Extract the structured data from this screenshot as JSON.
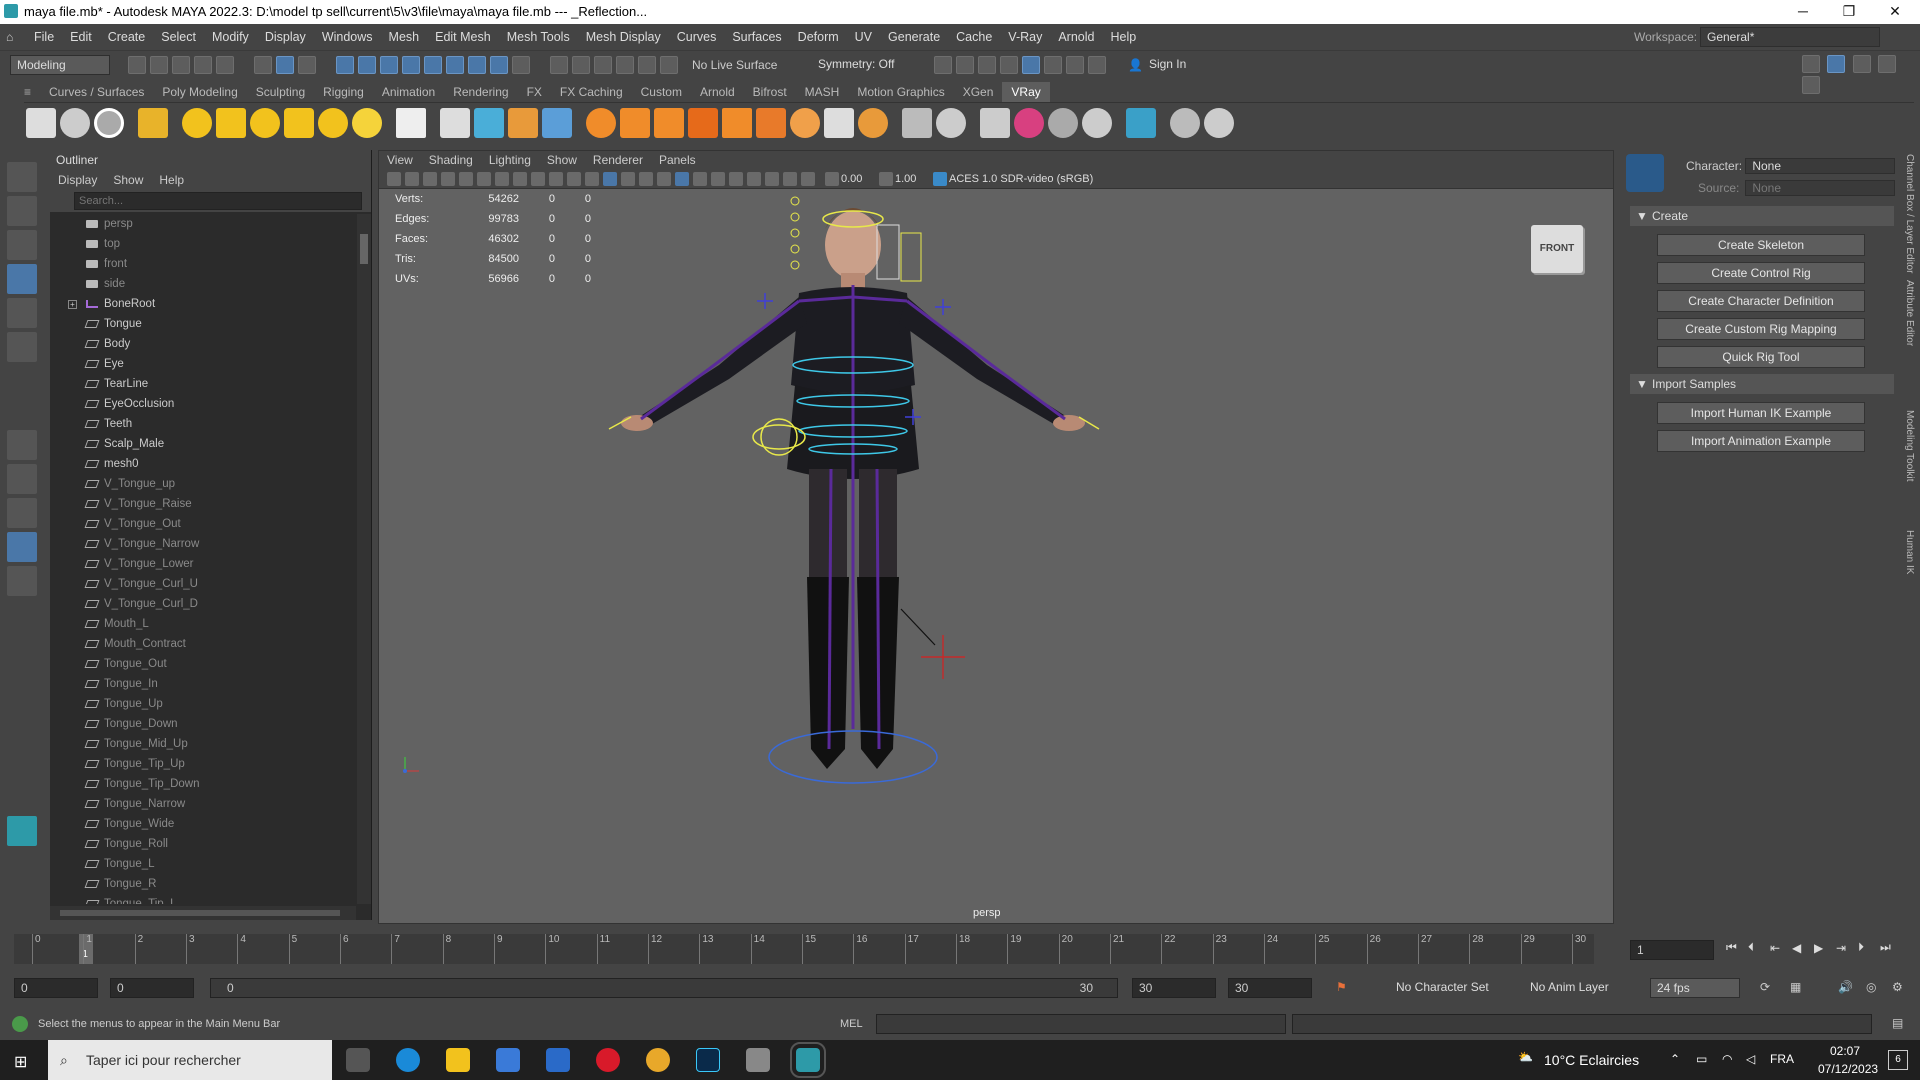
{
  "titlebar": {
    "title": "maya file.mb* - Autodesk MAYA 2022.3: D:\\model tp sell\\current\\5\\v3\\file\\maya\\maya file.mb  ---  _Reflection...",
    "minimize": "─",
    "maximize": "❐",
    "close": "✕"
  },
  "menubar": {
    "items": [
      "File",
      "Edit",
      "Create",
      "Select",
      "Modify",
      "Display",
      "Windows",
      "Mesh",
      "Edit Mesh",
      "Mesh Tools",
      "Mesh Display",
      "Curves",
      "Surfaces",
      "Deform",
      "UV",
      "Generate",
      "Cache",
      "V-Ray",
      "Arnold",
      "Help"
    ],
    "workspace_label": "Workspace:",
    "workspace_value": "General*"
  },
  "statusline": {
    "mode": "Modeling",
    "live_surface": "No Live Surface",
    "symmetry": "Symmetry: Off",
    "sign_in": "Sign In"
  },
  "shelf": {
    "tabs": [
      "Curves / Surfaces",
      "Poly Modeling",
      "Sculpting",
      "Rigging",
      "Animation",
      "Rendering",
      "FX",
      "FX Caching",
      "Custom",
      "Arnold",
      "Bifrost",
      "MASH",
      "Motion Graphics",
      "XGen",
      "VRay"
    ],
    "active": "VRay"
  },
  "outliner": {
    "title": "Outliner",
    "menu": [
      "Display",
      "Show",
      "Help"
    ],
    "search_placeholder": "Search...",
    "items": [
      {
        "label": "persp",
        "dim": true,
        "type": "camera"
      },
      {
        "label": "top",
        "dim": true,
        "type": "camera"
      },
      {
        "label": "front",
        "dim": true,
        "type": "camera"
      },
      {
        "label": "side",
        "dim": true,
        "type": "camera"
      },
      {
        "label": "BoneRoot",
        "dim": false,
        "type": "joint",
        "expandable": true
      },
      {
        "label": "Tongue",
        "dim": false,
        "type": "mesh"
      },
      {
        "label": "Body",
        "dim": false,
        "type": "mesh"
      },
      {
        "label": "Eye",
        "dim": false,
        "type": "mesh"
      },
      {
        "label": "TearLine",
        "dim": false,
        "type": "mesh"
      },
      {
        "label": "EyeOcclusion",
        "dim": false,
        "type": "mesh"
      },
      {
        "label": "Teeth",
        "dim": false,
        "type": "mesh"
      },
      {
        "label": "Scalp_Male",
        "dim": false,
        "type": "mesh"
      },
      {
        "label": "mesh0",
        "dim": false,
        "type": "mesh"
      },
      {
        "label": "V_Tongue_up",
        "dim": true,
        "type": "mesh"
      },
      {
        "label": "V_Tongue_Raise",
        "dim": true,
        "type": "mesh"
      },
      {
        "label": "V_Tongue_Out",
        "dim": true,
        "type": "mesh"
      },
      {
        "label": "V_Tongue_Narrow",
        "dim": true,
        "type": "mesh"
      },
      {
        "label": "V_Tongue_Lower",
        "dim": true,
        "type": "mesh"
      },
      {
        "label": "V_Tongue_Curl_U",
        "dim": true,
        "type": "mesh"
      },
      {
        "label": "V_Tongue_Curl_D",
        "dim": true,
        "type": "mesh"
      },
      {
        "label": "Mouth_L",
        "dim": true,
        "type": "mesh"
      },
      {
        "label": "Mouth_Contract",
        "dim": true,
        "type": "mesh"
      },
      {
        "label": "Tongue_Out",
        "dim": true,
        "type": "mesh"
      },
      {
        "label": "Tongue_In",
        "dim": true,
        "type": "mesh"
      },
      {
        "label": "Tongue_Up",
        "dim": true,
        "type": "mesh"
      },
      {
        "label": "Tongue_Down",
        "dim": true,
        "type": "mesh"
      },
      {
        "label": "Tongue_Mid_Up",
        "dim": true,
        "type": "mesh"
      },
      {
        "label": "Tongue_Tip_Up",
        "dim": true,
        "type": "mesh"
      },
      {
        "label": "Tongue_Tip_Down",
        "dim": true,
        "type": "mesh"
      },
      {
        "label": "Tongue_Narrow",
        "dim": true,
        "type": "mesh"
      },
      {
        "label": "Tongue_Wide",
        "dim": true,
        "type": "mesh"
      },
      {
        "label": "Tongue_Roll",
        "dim": true,
        "type": "mesh"
      },
      {
        "label": "Tongue_L",
        "dim": true,
        "type": "mesh"
      },
      {
        "label": "Tongue_R",
        "dim": true,
        "type": "mesh"
      },
      {
        "label": "Tongue_Tip_L",
        "dim": true,
        "type": "mesh"
      }
    ]
  },
  "viewport": {
    "menu": [
      "View",
      "Shading",
      "Lighting",
      "Show",
      "Renderer",
      "Panels"
    ],
    "exposure": "0.00",
    "gamma": "1.00",
    "color_space": "ACES 1.0 SDR-video (sRGB)",
    "hud": [
      {
        "label": "Verts:",
        "v1": "54262",
        "v2": "0",
        "v3": "0"
      },
      {
        "label": "Edges:",
        "v1": "99783",
        "v2": "0",
        "v3": "0"
      },
      {
        "label": "Faces:",
        "v1": "46302",
        "v2": "0",
        "v3": "0"
      },
      {
        "label": "Tris:",
        "v1": "84500",
        "v2": "0",
        "v3": "0"
      },
      {
        "label": "UVs:",
        "v1": "56966",
        "v2": "0",
        "v3": "0"
      }
    ],
    "viewcube": "FRONT",
    "camera": "persp"
  },
  "hik": {
    "character_label": "Character:",
    "character_value": "None",
    "source_label": "Source:",
    "source_value": "None",
    "create_section": "Create",
    "create_buttons": [
      "Create Skeleton",
      "Create Control Rig",
      "Create Character Definition",
      "Create Custom Rig Mapping",
      "Quick Rig Tool"
    ],
    "import_section": "Import Samples",
    "import_buttons": [
      "Import Human IK Example",
      "Import Animation Example"
    ]
  },
  "sidetabs": [
    "Channel Box / Layer Editor",
    "Attribute Editor",
    "Modeling Toolkit",
    "Human IK"
  ],
  "timeslider": {
    "ticks": [
      "0",
      "1",
      "2",
      "3",
      "4",
      "5",
      "6",
      "7",
      "8",
      "9",
      "10",
      "11",
      "12",
      "13",
      "14",
      "15",
      "16",
      "17",
      "18",
      "19",
      "20",
      "21",
      "22",
      "23",
      "24",
      "25",
      "26",
      "27",
      "28",
      "29",
      "30"
    ],
    "current_frame": "1",
    "current_field": "1"
  },
  "range": {
    "start": "0",
    "anim_start": "0",
    "range_start": "0",
    "range_end": "30",
    "anim_end": "30",
    "end": "30",
    "character_set": "No Character Set",
    "anim_layer": "No Anim Layer",
    "fps": "24 fps"
  },
  "cmdline": {
    "help": "Select the menus to appear in the Main Menu Bar",
    "lang": "MEL"
  },
  "taskbar": {
    "search": "Taper ici pour rechercher",
    "weather": "10°C  Eclaircies",
    "lang": "FRA",
    "time": "02:07",
    "date": "07/12/2023",
    "notifications": "6"
  }
}
